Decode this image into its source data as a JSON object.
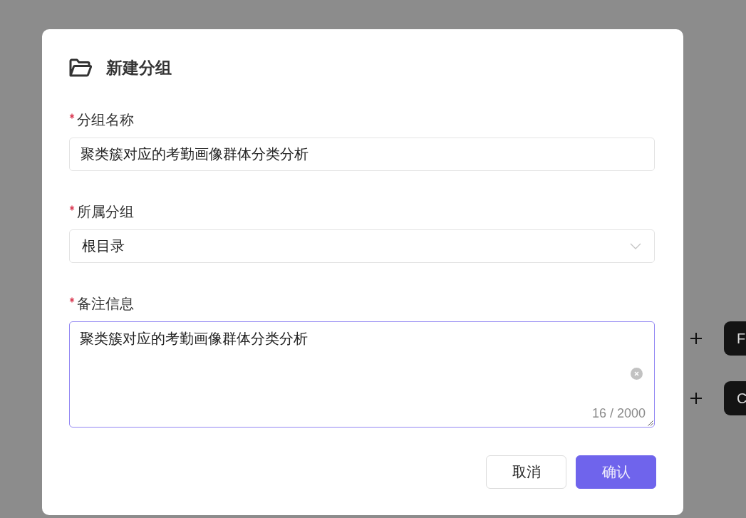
{
  "dialog": {
    "title": "新建分组",
    "fields": [
      {
        "kind": "text",
        "label": "分组名称",
        "required": true,
        "value": "聚类簇对应的考勤画像群体分类分析"
      },
      {
        "kind": "select",
        "label": "所属分组",
        "required": true,
        "value": "根目录"
      },
      {
        "kind": "textarea",
        "label": "备注信息",
        "required": true,
        "value": "聚类簇对应的考勤画像群体分类分析",
        "focused": true,
        "counter": "16 / 2000"
      }
    ],
    "buttons": [
      {
        "label": "取消",
        "kind": "default"
      },
      {
        "label": "确认",
        "kind": "primary"
      }
    ]
  },
  "background": {
    "actions": [
      {
        "label": "F"
      },
      {
        "label": "C"
      }
    ]
  }
}
